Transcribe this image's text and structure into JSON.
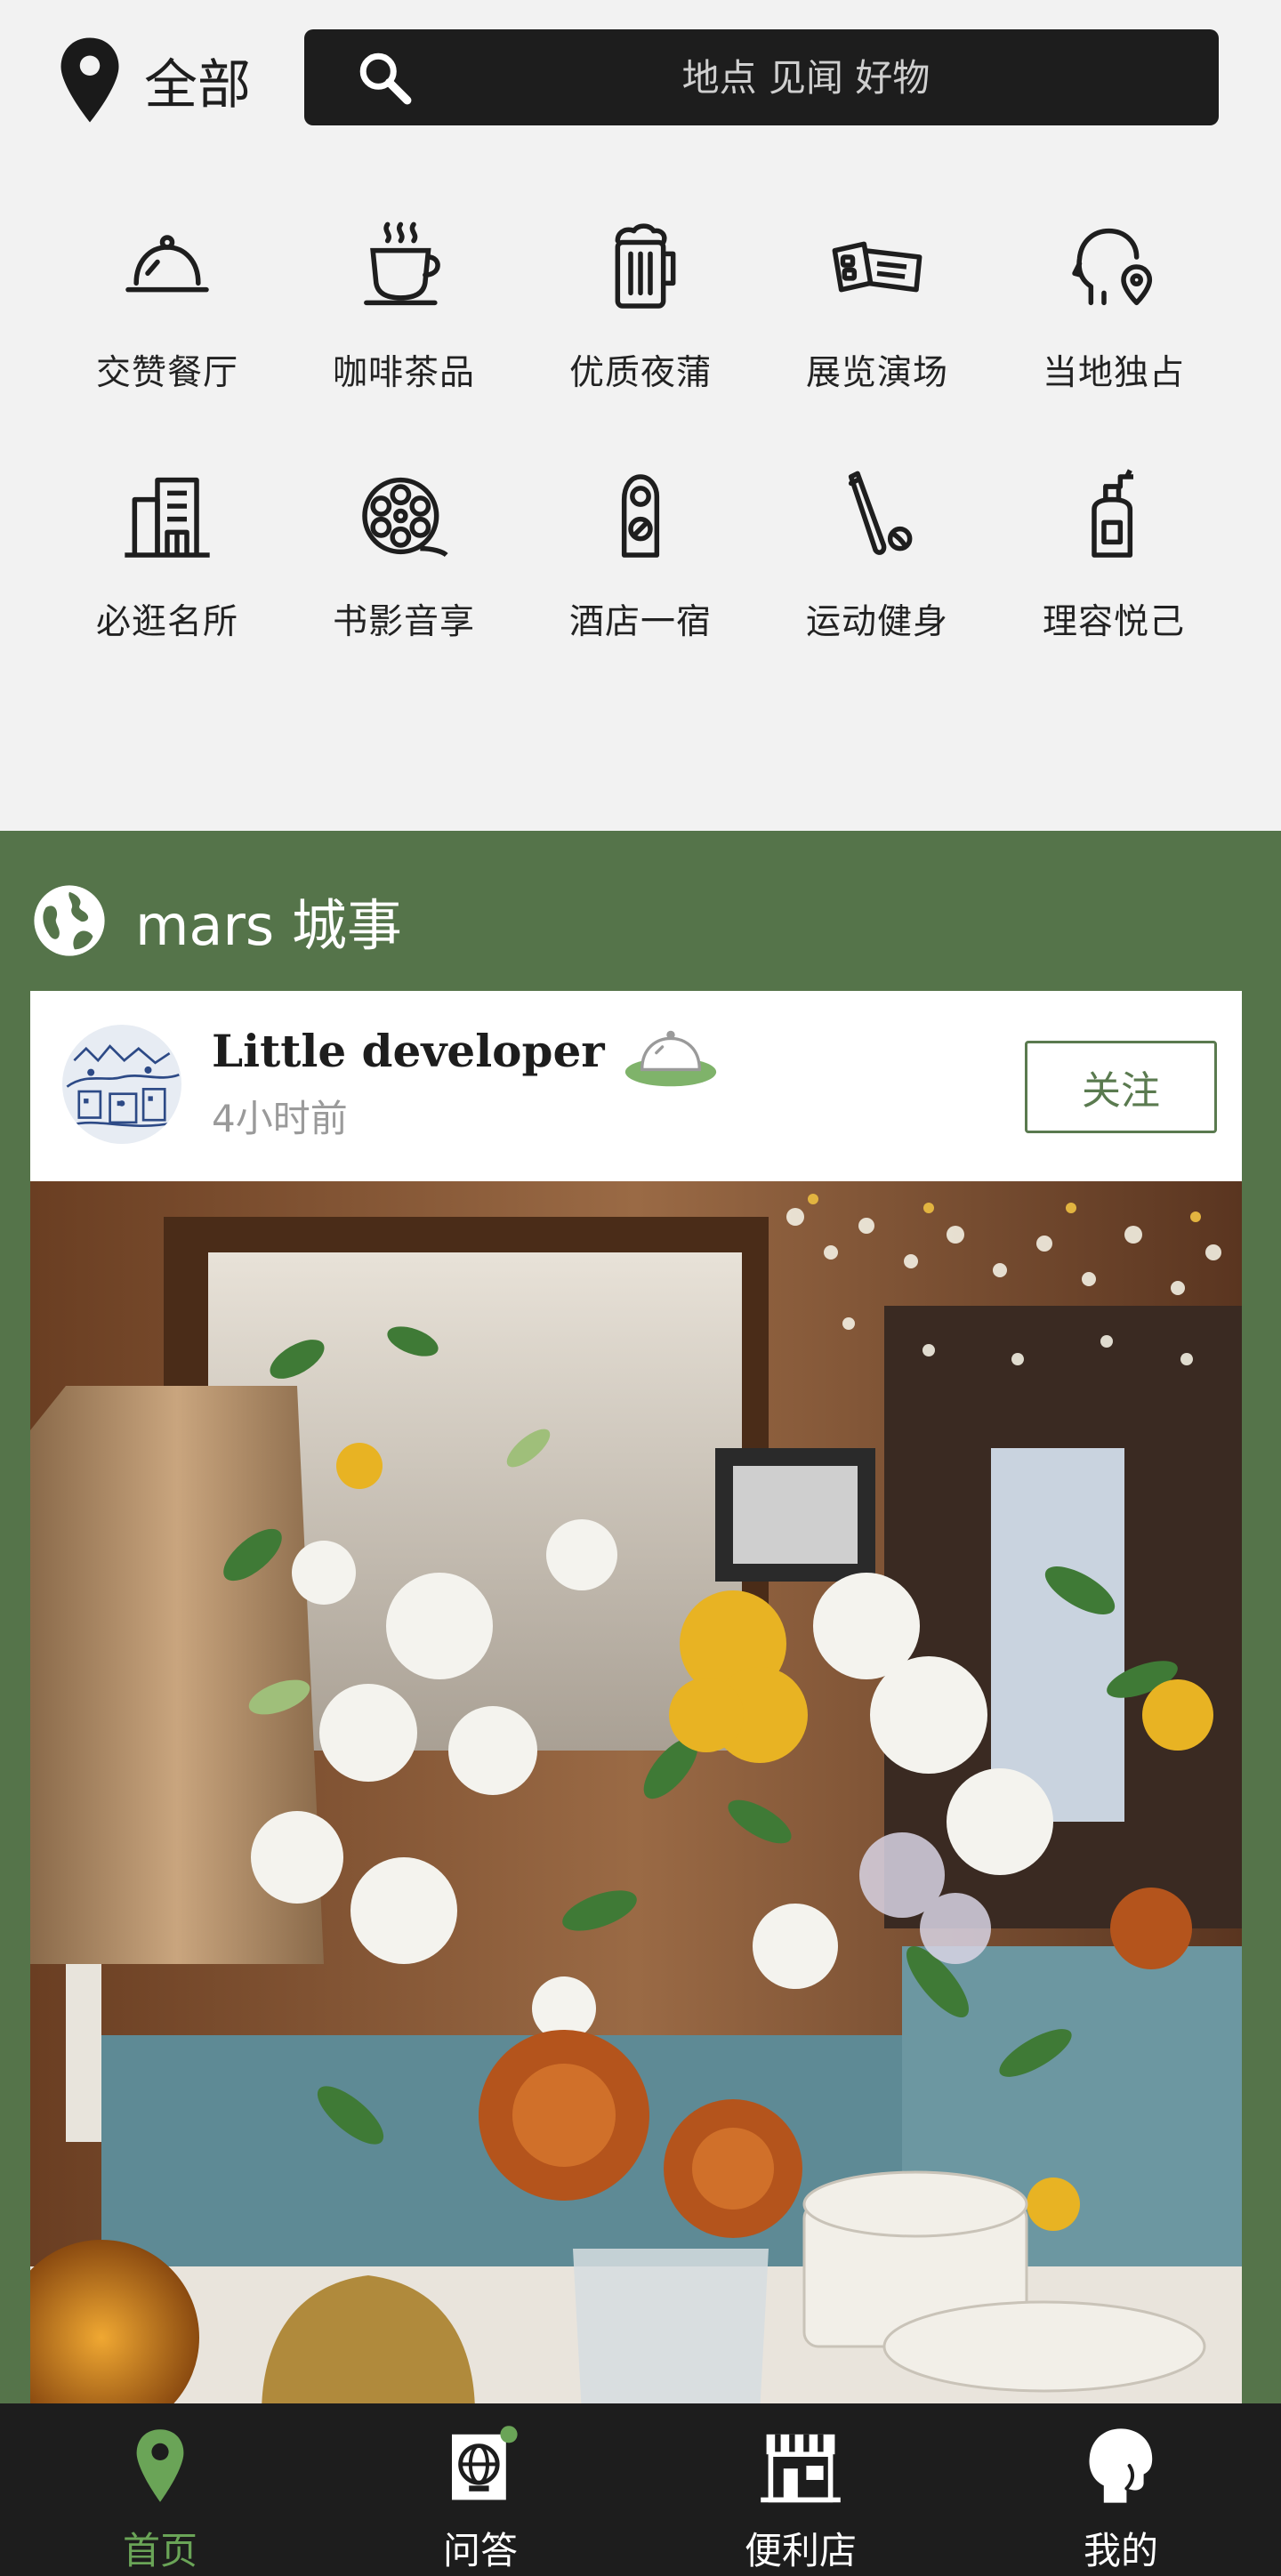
{
  "colors": {
    "accent_green": "#55744a",
    "active_nav": "#6aa457",
    "dark": "#1d1d1d"
  },
  "header": {
    "location_label": "全部",
    "location_icon": "map-pin-icon",
    "search": {
      "placeholder": "地点 见闻 好物",
      "value": "",
      "icon": "search-icon"
    }
  },
  "categories": [
    {
      "label": "交赞餐厅",
      "icon": "cloche-icon"
    },
    {
      "label": "咖啡茶品",
      "icon": "coffee-cup-icon"
    },
    {
      "label": "优质夜蒲",
      "icon": "beer-mug-icon"
    },
    {
      "label": "展览演场",
      "icon": "tickets-icon"
    },
    {
      "label": "当地独占",
      "icon": "local-head-pin-icon"
    },
    {
      "label": "必逛名所",
      "icon": "building-icon"
    },
    {
      "label": "书影音享",
      "icon": "film-reel-icon"
    },
    {
      "label": "酒店一宿",
      "icon": "door-hanger-icon"
    },
    {
      "label": "运动健身",
      "icon": "bat-ball-icon"
    },
    {
      "label": "理容悦己",
      "icon": "pump-bottle-icon"
    }
  ],
  "feed": {
    "section_title": "mars 城事",
    "section_icon": "globe-icon",
    "post": {
      "author": "Little developer",
      "time": "4小时前",
      "follow_label": "关注",
      "badge_icon": "cloche-badge-icon",
      "image_subject": "flower-arrangement-photo"
    }
  },
  "bottom_nav": [
    {
      "label": "首页",
      "icon": "map-pin-icon",
      "active": true
    },
    {
      "label": "问答",
      "icon": "globe-notification-icon",
      "active": false
    },
    {
      "label": "便利店",
      "icon": "storefront-icon",
      "active": false
    },
    {
      "label": "我的",
      "icon": "profile-head-icon",
      "active": false
    }
  ]
}
